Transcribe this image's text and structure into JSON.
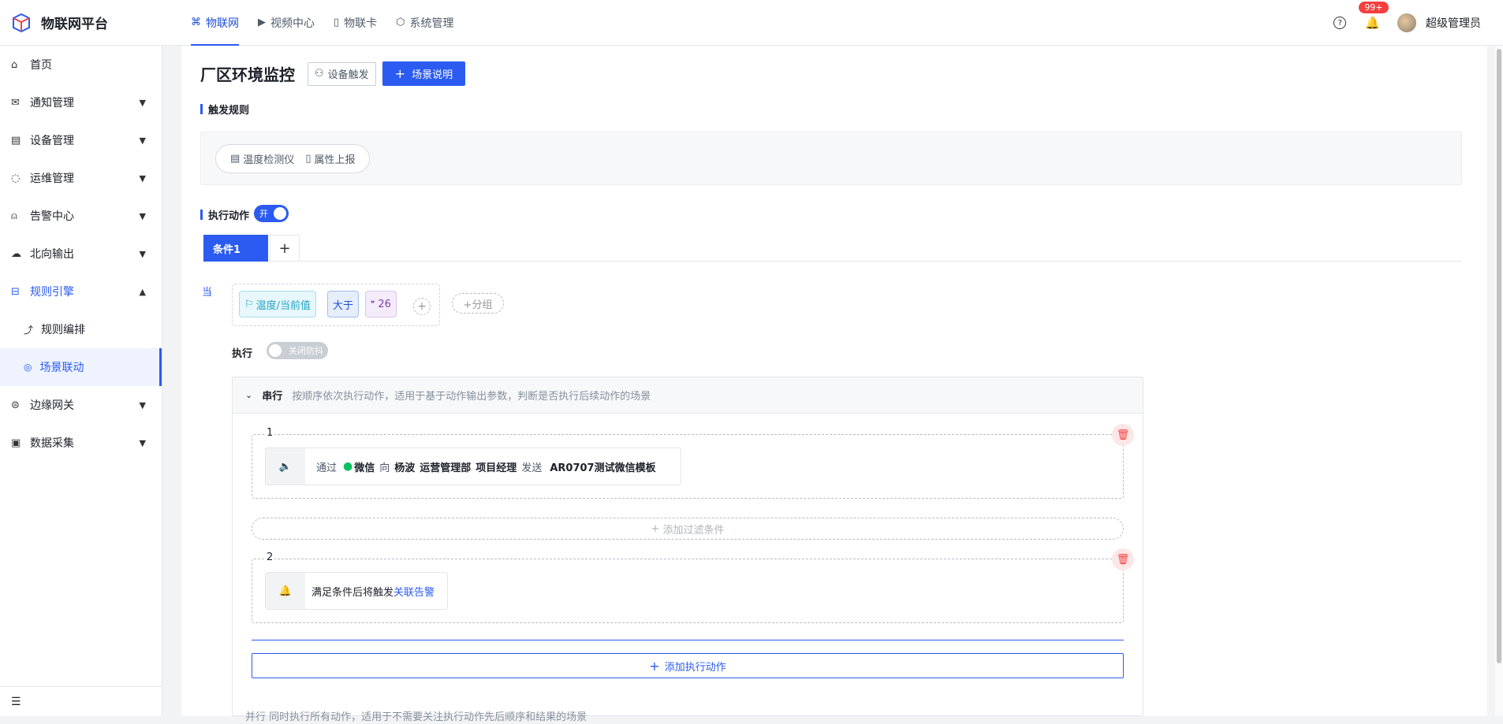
{
  "app": {
    "name": "物联网平台"
  },
  "topnav": [
    {
      "label": "物联网",
      "icon": "network-icon",
      "active": true
    },
    {
      "label": "视频中心",
      "icon": "video-icon",
      "active": false
    },
    {
      "label": "物联卡",
      "icon": "sim-card-icon",
      "active": false
    },
    {
      "label": "系统管理",
      "icon": "system-icon",
      "active": false
    }
  ],
  "header": {
    "badge": "99+",
    "username": "超级管理员"
  },
  "sidebar": {
    "items": [
      {
        "label": "首页"
      },
      {
        "label": "通知管理"
      },
      {
        "label": "设备管理"
      },
      {
        "label": "运维管理"
      },
      {
        "label": "告警中心"
      },
      {
        "label": "北向输出"
      },
      {
        "label": "规则引擎"
      },
      {
        "label": "边缘网关"
      },
      {
        "label": "数据采集"
      }
    ],
    "sub": [
      {
        "label": "规则编排"
      },
      {
        "label": "场景联动"
      }
    ]
  },
  "page": {
    "title": "厂区环境监控",
    "trigger_btn": "设备触发",
    "desc_btn": "场景说明",
    "trigger_label": "触发规则",
    "trigger_device": "温度检测仪",
    "trigger_type": "属性上报",
    "action_label": "执行动作",
    "toggle_on": "开",
    "tab": "条件1",
    "when": "当",
    "cond_field": "温度/当前值",
    "cond_op": "大于",
    "cond_val": "26",
    "group_add": "+分组",
    "exec_label": "执行",
    "debounce": "关闭防抖",
    "serial_title": "串行",
    "serial_desc": "按顺序依次执行动作，适用于基于动作输出参数，判断是否执行后续动作的场景",
    "action1": {
      "num": "1",
      "via": "通过",
      "channel": "微信",
      "to": "向",
      "user": "杨波",
      "dept": "运营管理部",
      "role": "项目经理",
      "send": "发送",
      "template": "AR0707测试微信模板"
    },
    "filter_add": "添加过滤条件",
    "action2": {
      "num": "2",
      "text": "满足条件后将触发",
      "link": "关联告警"
    },
    "add_exec": "添加执行动作",
    "parallel_peek": "并行  同时执行所有动作，适用于不需要关注执行动作先后顺序和结果的场景"
  }
}
